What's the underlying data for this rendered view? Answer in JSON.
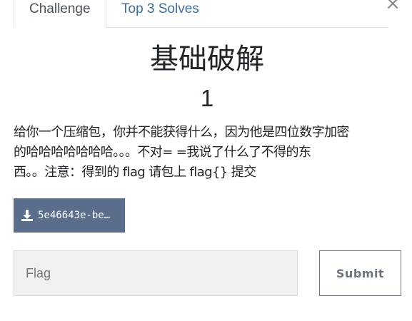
{
  "tabs": [
    {
      "label": "Challenge",
      "active": true
    },
    {
      "label": "Top 3 Solves",
      "active": false
    }
  ],
  "close_glyph": "×",
  "challenge": {
    "title": "基础破解",
    "points": "1",
    "description_lines": [
      "给你一个压缩包，你并不能获得什么，因为他是四位数字加密",
      "的哈哈哈哈哈哈哈。。。不对= =我说了什么了不得的东",
      "西。。注意：得到的 flag 请包上 flag{} 提交"
    ]
  },
  "file": {
    "label": "5e46643e-be…",
    "icon": "download-icon"
  },
  "flag_input": {
    "placeholder": "Flag",
    "value": ""
  },
  "submit": {
    "label": "Submit"
  },
  "colors": {
    "tab_link": "#3c6e9f",
    "file_button_bg": "#5a6e8c",
    "input_bg": "#f0f0f0",
    "submit_border": "#6c757d"
  }
}
